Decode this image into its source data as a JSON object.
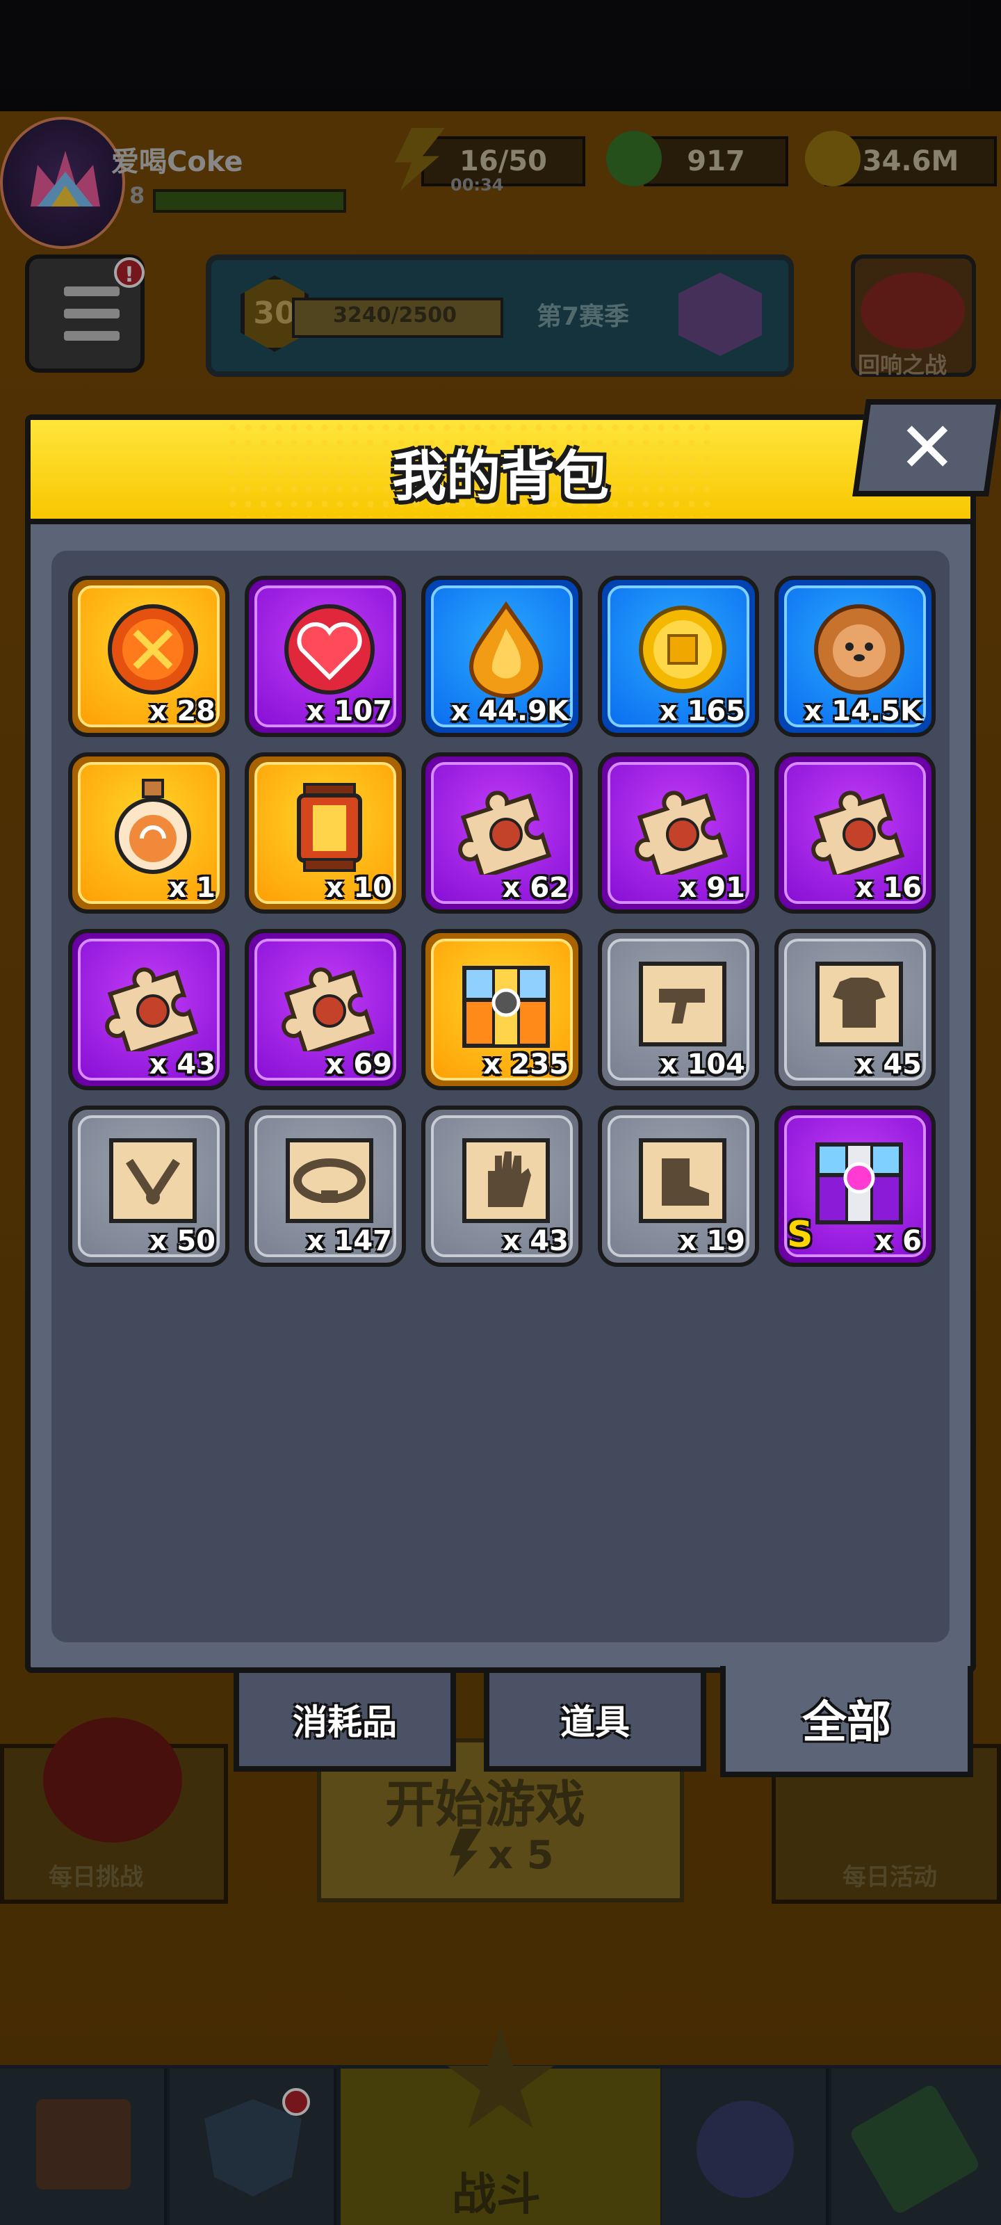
{
  "top": {
    "username": "爱喝Coke",
    "level_partial": "8",
    "energy": "16/50",
    "energy_timer": "00:34",
    "gems": "917",
    "coins": "34.6M"
  },
  "season": {
    "level": "30",
    "progress": "3240/2500",
    "label": "第7赛季"
  },
  "echo_battle_label": "回响之战",
  "daily_challenge_label": "每日挑战",
  "daily_event_label": "每日活动",
  "start_game": {
    "title": "开始游戏",
    "cost": "x 5"
  },
  "nav": {
    "fight_label": "战斗"
  },
  "modal": {
    "title": "我的背包",
    "close_symbol": "✕",
    "items": [
      {
        "name": "orange-orb",
        "rarity": "gold",
        "count": "x 28",
        "icon": "dna-orb-icon"
      },
      {
        "name": "heart-orb",
        "rarity": "purple",
        "count": "x 107",
        "icon": "heart-icon"
      },
      {
        "name": "flame-drop",
        "rarity": "blue",
        "count": "x 44.9K",
        "icon": "flame-drop-icon"
      },
      {
        "name": "gold-coin",
        "rarity": "blue",
        "count": "x 165",
        "icon": "coin-icon"
      },
      {
        "name": "dog-cookie",
        "rarity": "blue",
        "count": "x 14.5K",
        "icon": "dog-cookie-icon"
      },
      {
        "name": "potion",
        "rarity": "gold",
        "count": "x 1",
        "icon": "potion-icon"
      },
      {
        "name": "lantern",
        "rarity": "gold",
        "count": "x 10",
        "icon": "lantern-icon"
      },
      {
        "name": "puzzle-1",
        "rarity": "purple",
        "count": "x 62",
        "icon": "puzzle-piece-icon"
      },
      {
        "name": "puzzle-2",
        "rarity": "purple",
        "count": "x 91",
        "icon": "puzzle-piece-icon"
      },
      {
        "name": "puzzle-3",
        "rarity": "purple",
        "count": "x 16",
        "icon": "puzzle-piece-icon"
      },
      {
        "name": "puzzle-4",
        "rarity": "purple",
        "count": "x 43",
        "icon": "puzzle-piece-icon"
      },
      {
        "name": "puzzle-5",
        "rarity": "purple",
        "count": "x 69",
        "icon": "puzzle-piece-icon"
      },
      {
        "name": "treasure-chest",
        "rarity": "gold",
        "count": "x 235",
        "icon": "chest-icon"
      },
      {
        "name": "weapon-scroll",
        "rarity": "gray",
        "count": "x 104",
        "icon": "gun-scroll-icon"
      },
      {
        "name": "armor-scroll",
        "rarity": "gray",
        "count": "x 45",
        "icon": "shirt-scroll-icon"
      },
      {
        "name": "necklace-scroll",
        "rarity": "gray",
        "count": "x 50",
        "icon": "necklace-scroll-icon"
      },
      {
        "name": "belt-scroll",
        "rarity": "gray",
        "count": "x 147",
        "icon": "belt-scroll-icon"
      },
      {
        "name": "glove-scroll",
        "rarity": "gray",
        "count": "x 43",
        "icon": "glove-scroll-icon"
      },
      {
        "name": "boots-scroll",
        "rarity": "gray",
        "count": "x 19",
        "icon": "boots-scroll-icon"
      },
      {
        "name": "s-chest",
        "rarity": "purple",
        "count": "x 6",
        "icon": "s-chest-icon",
        "badge": "S"
      }
    ],
    "tabs": {
      "consumables": "消耗品",
      "props": "道具",
      "all": "全部"
    }
  }
}
